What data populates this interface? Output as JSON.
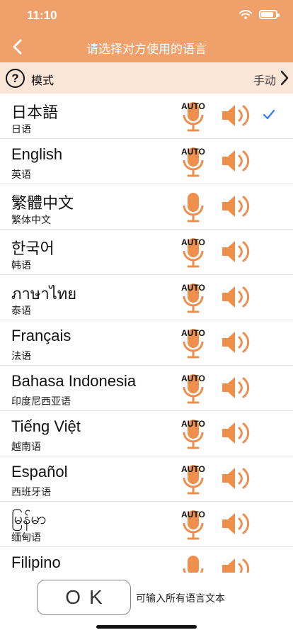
{
  "status": {
    "time": "11:10"
  },
  "header": {
    "title": "请选择对方使用的语言"
  },
  "mode": {
    "help": "?",
    "label": "模式",
    "value": "手动"
  },
  "colors": {
    "accent": "#f0a06a",
    "icon": "#ef8f4e",
    "check": "#2f7cf6"
  },
  "languages": [
    {
      "native": "日本語",
      "cn": "日语",
      "auto": "AUTO",
      "selected": true
    },
    {
      "native": "English",
      "cn": "英语",
      "auto": "AUTO",
      "selected": false
    },
    {
      "native": "繁體中文",
      "cn": "繁体中文",
      "auto": "",
      "selected": false
    },
    {
      "native": "한국어",
      "cn": "韩语",
      "auto": "AUTO",
      "selected": false
    },
    {
      "native": "ภาษาไทย",
      "cn": "泰语",
      "auto": "AUTO",
      "selected": false
    },
    {
      "native": "Français",
      "cn": "法语",
      "auto": "AUTO",
      "selected": false
    },
    {
      "native": "Bahasa Indonesia",
      "cn": "印度尼西亚语",
      "auto": "AUTO",
      "selected": false
    },
    {
      "native": "Tiếng Việt",
      "cn": "越南语",
      "auto": "AUTO",
      "selected": false
    },
    {
      "native": "Español",
      "cn": "西班牙语",
      "auto": "AUTO",
      "selected": false
    },
    {
      "native": "မြန်မာ",
      "cn": "缅甸语",
      "auto": "AUTO",
      "selected": false
    },
    {
      "native": "Filipino",
      "cn": "",
      "auto": "",
      "selected": false
    }
  ],
  "footer": {
    "ok_label": "OK",
    "hint": "可输入所有语言文本"
  }
}
